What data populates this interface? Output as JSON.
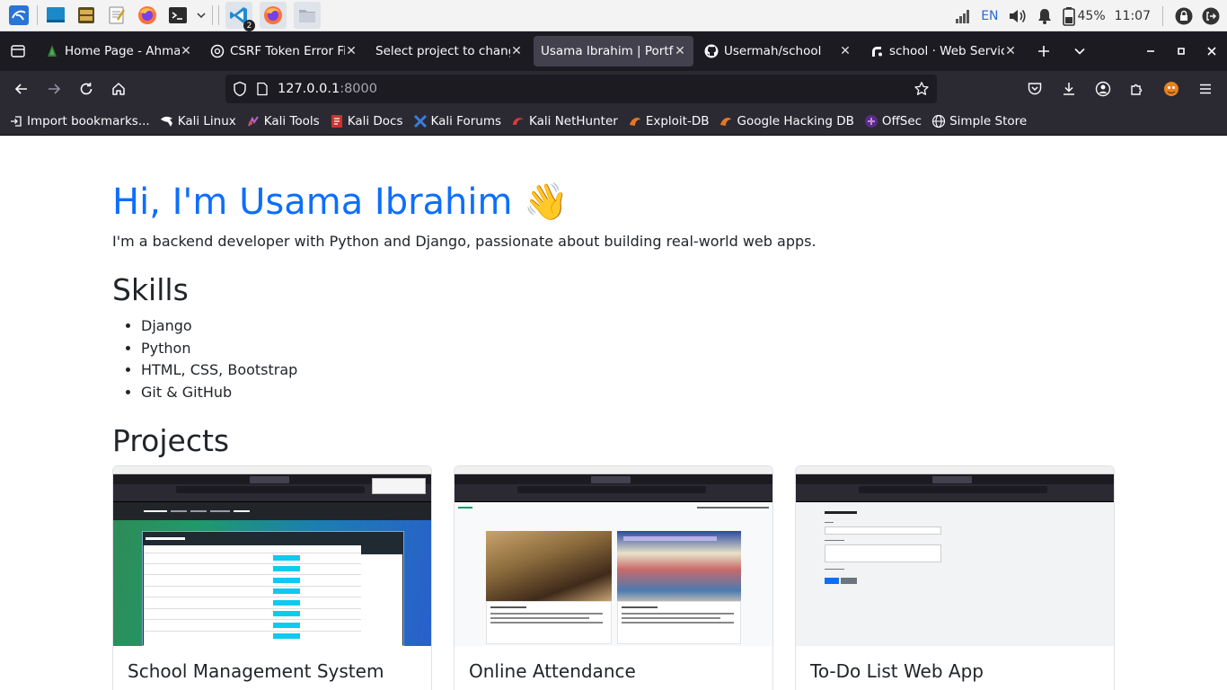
{
  "taskbar": {
    "apps": [
      "kali-menu",
      "desktop",
      "file-manager-panel",
      "text-editor",
      "firefox",
      "terminal"
    ],
    "tasks": [
      "vscode",
      "firefox",
      "files"
    ],
    "vscode_count": "2",
    "lang": "EN",
    "battery": "45%",
    "time": "11:07"
  },
  "browser": {
    "tabs": [
      {
        "title": "Home Page - Ahmad",
        "active": false
      },
      {
        "title": "CSRF Token Error Fix",
        "active": false
      },
      {
        "title": "Select project to change",
        "active": false
      },
      {
        "title": "Usama Ibrahim | Portfolio",
        "active": true
      },
      {
        "title": "Usermah/school",
        "active": false
      },
      {
        "title": "school · Web Service",
        "active": false
      }
    ],
    "url_host": "127.0.0.1",
    "url_port": ":8000",
    "bookmarks": [
      "Import bookmarks...",
      "Kali Linux",
      "Kali Tools",
      "Kali Docs",
      "Kali Forums",
      "Kali NetHunter",
      "Exploit-DB",
      "Google Hacking DB",
      "OffSec",
      "Simple Store"
    ]
  },
  "page": {
    "title": "Hi, I'm Usama Ibrahim",
    "title_emoji": "👋",
    "subtitle": "I'm a backend developer with Python and Django, passionate about building real-world web apps.",
    "skills_heading": "Skills",
    "skills": [
      "Django",
      "Python",
      "HTML, CSS, Bootstrap",
      "Git & GitHub"
    ],
    "projects_heading": "Projects",
    "projects": [
      {
        "title": "School Management System"
      },
      {
        "title": "Online Attendance"
      },
      {
        "title": "To-Do List Web App"
      }
    ]
  },
  "colors": {
    "accent": "#0d6efd",
    "browser_tabbar": "#1c1b22",
    "browser_toolbar": "#2b2a33",
    "active_tab": "#42414d"
  }
}
